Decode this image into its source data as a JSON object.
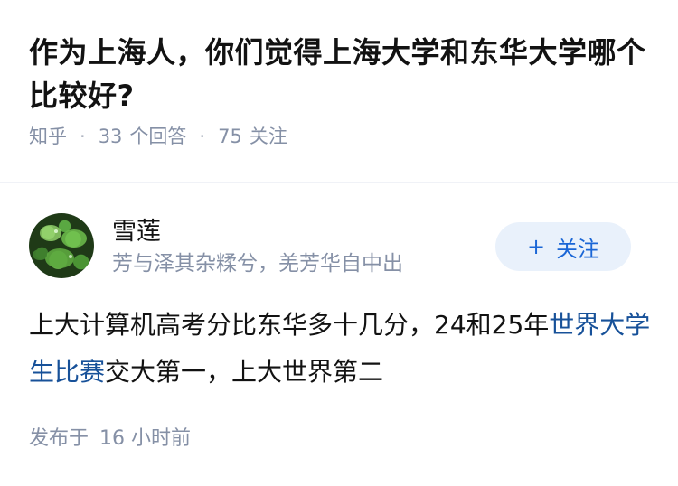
{
  "question": {
    "title": "作为上海人，你们觉得上海大学和东华大学哪个比较好?",
    "source": "知乎",
    "answer_count": "33",
    "answer_label": "个回答",
    "follower_count": "75",
    "follower_label": "关注",
    "separator": "·"
  },
  "author": {
    "name": "雪莲",
    "bio": "芳与泽其杂糅兮，羌芳华自中出",
    "avatar_icon": "lotus-leaves-photo"
  },
  "follow_button": {
    "icon": "+",
    "label": "关注"
  },
  "answer": {
    "text_before_link": "上大计算机高考分比东华多十几分，24和25年",
    "link_text": "世界大学生比赛",
    "text_after_link": "交大第一，上大世界第二"
  },
  "publish": {
    "label": "发布于",
    "time": "16 小时前"
  },
  "colors": {
    "text": "#121212",
    "muted": "#8590a6",
    "link": "#175199",
    "follow_bg": "#e9f1fb",
    "follow_text": "#1a66d6"
  }
}
